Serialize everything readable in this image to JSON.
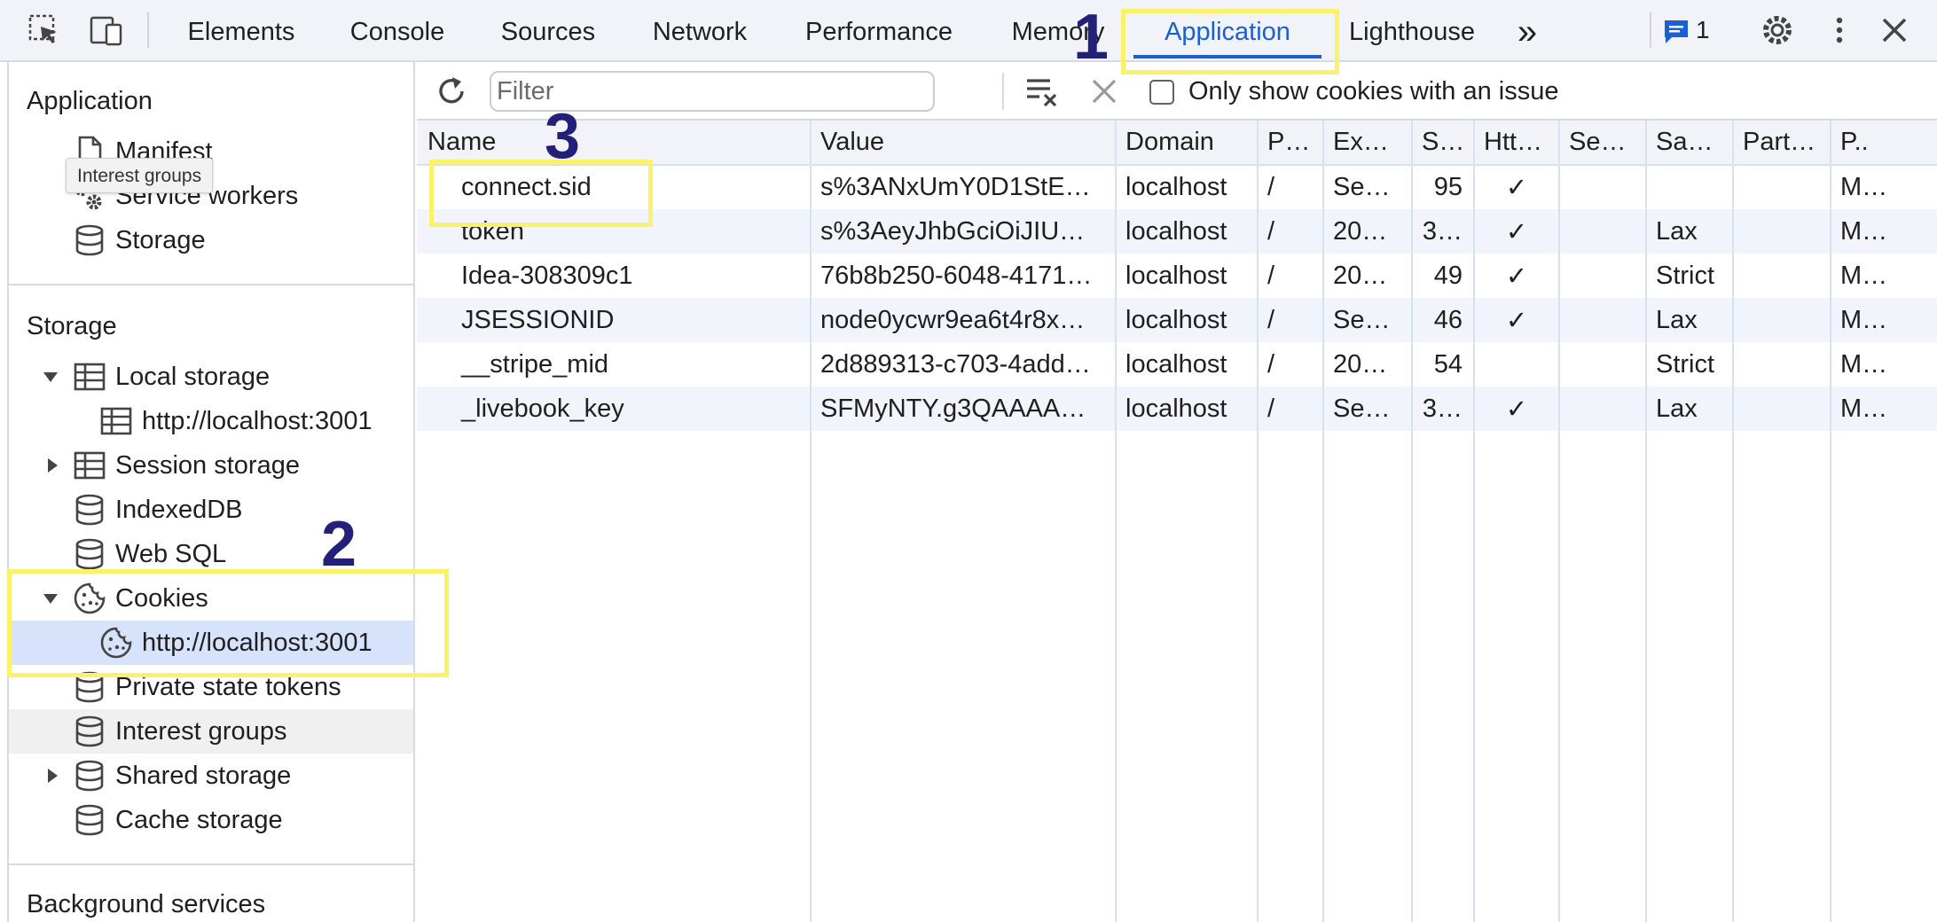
{
  "devtools": {
    "tabs": [
      {
        "label": "Elements"
      },
      {
        "label": "Console"
      },
      {
        "label": "Sources"
      },
      {
        "label": "Network"
      },
      {
        "label": "Performance"
      },
      {
        "label": "Memory"
      },
      {
        "label": "Application",
        "active": true
      },
      {
        "label": "Lighthouse"
      }
    ],
    "more_tabs_glyph": "»",
    "issues_count": "1",
    "accent_color": "#1a5fd6"
  },
  "sidebar": {
    "application_heading": "Application",
    "tooltip": "Interest groups",
    "application_items": [
      {
        "label": "Manifest",
        "icon": "document-icon"
      },
      {
        "label": "Service workers",
        "icon": "gears-icon"
      },
      {
        "label": "Storage",
        "icon": "database-icon"
      }
    ],
    "storage_heading": "Storage",
    "storage_items": [
      {
        "label": "Local storage",
        "icon": "table-icon",
        "expanded": true
      },
      {
        "label": "http://localhost:3001",
        "icon": "table-icon"
      },
      {
        "label": "Session storage",
        "icon": "table-icon",
        "expanded": false
      },
      {
        "label": "IndexedDB",
        "icon": "database-icon"
      },
      {
        "label": "Web SQL",
        "icon": "database-icon"
      },
      {
        "label": "Cookies",
        "icon": "cookie-icon",
        "expanded": true
      },
      {
        "label": "http://localhost:3001",
        "icon": "cookie-icon",
        "selected": true
      },
      {
        "label": "Private state tokens",
        "icon": "database-icon"
      },
      {
        "label": "Interest groups",
        "icon": "database-icon",
        "hovered": true
      },
      {
        "label": "Shared storage",
        "icon": "database-icon",
        "expanded": false
      },
      {
        "label": "Cache storage",
        "icon": "database-icon"
      }
    ],
    "background_heading": "Background services"
  },
  "toolbar": {
    "filter_placeholder": "Filter",
    "only_issues_label": "Only show cookies with an issue",
    "only_issues_checked": false
  },
  "table": {
    "columns": [
      "Name",
      "Value",
      "Domain",
      "P…",
      "Ex…",
      "S…",
      "Htt…",
      "Se…",
      "Sa…",
      "Part…",
      "P.."
    ],
    "rows": [
      {
        "name": "connect.sid",
        "value": "s%3ANxUmY0D1StE…",
        "domain": "localhost",
        "path": "/",
        "expires": "Se…",
        "size": "95",
        "httponly": "✓",
        "secure": "",
        "samesite": "",
        "partition": "",
        "priority": "M…"
      },
      {
        "name": "token",
        "value": "s%3AeyJhbGciOiJIU…",
        "domain": "localhost",
        "path": "/",
        "expires": "20…",
        "size": "3…",
        "httponly": "✓",
        "secure": "",
        "samesite": "Lax",
        "partition": "",
        "priority": "M…"
      },
      {
        "name": "Idea-308309c1",
        "value": "76b8b250-6048-4171…",
        "domain": "localhost",
        "path": "/",
        "expires": "20…",
        "size": "49",
        "httponly": "✓",
        "secure": "",
        "samesite": "Strict",
        "partition": "",
        "priority": "M…"
      },
      {
        "name": "JSESSIONID",
        "value": "node0ycwr9ea6t4r8x…",
        "domain": "localhost",
        "path": "/",
        "expires": "Se…",
        "size": "46",
        "httponly": "✓",
        "secure": "",
        "samesite": "Lax",
        "partition": "",
        "priority": "M…"
      },
      {
        "name": "__stripe_mid",
        "value": "2d889313-c703-4add…",
        "domain": "localhost",
        "path": "/",
        "expires": "20…",
        "size": "54",
        "httponly": "",
        "secure": "",
        "samesite": "Strict",
        "partition": "",
        "priority": "M…"
      },
      {
        "name": "_livebook_key",
        "value": "SFMyNTY.g3QAAAA…",
        "domain": "localhost",
        "path": "/",
        "expires": "Se…",
        "size": "3…",
        "httponly": "✓",
        "secure": "",
        "samesite": "Lax",
        "partition": "",
        "priority": "M…"
      }
    ]
  },
  "annotations": {
    "step1": "1",
    "step2": "2",
    "step3": "3",
    "highlight_color": "#faf26a",
    "number_color": "#23207a"
  }
}
